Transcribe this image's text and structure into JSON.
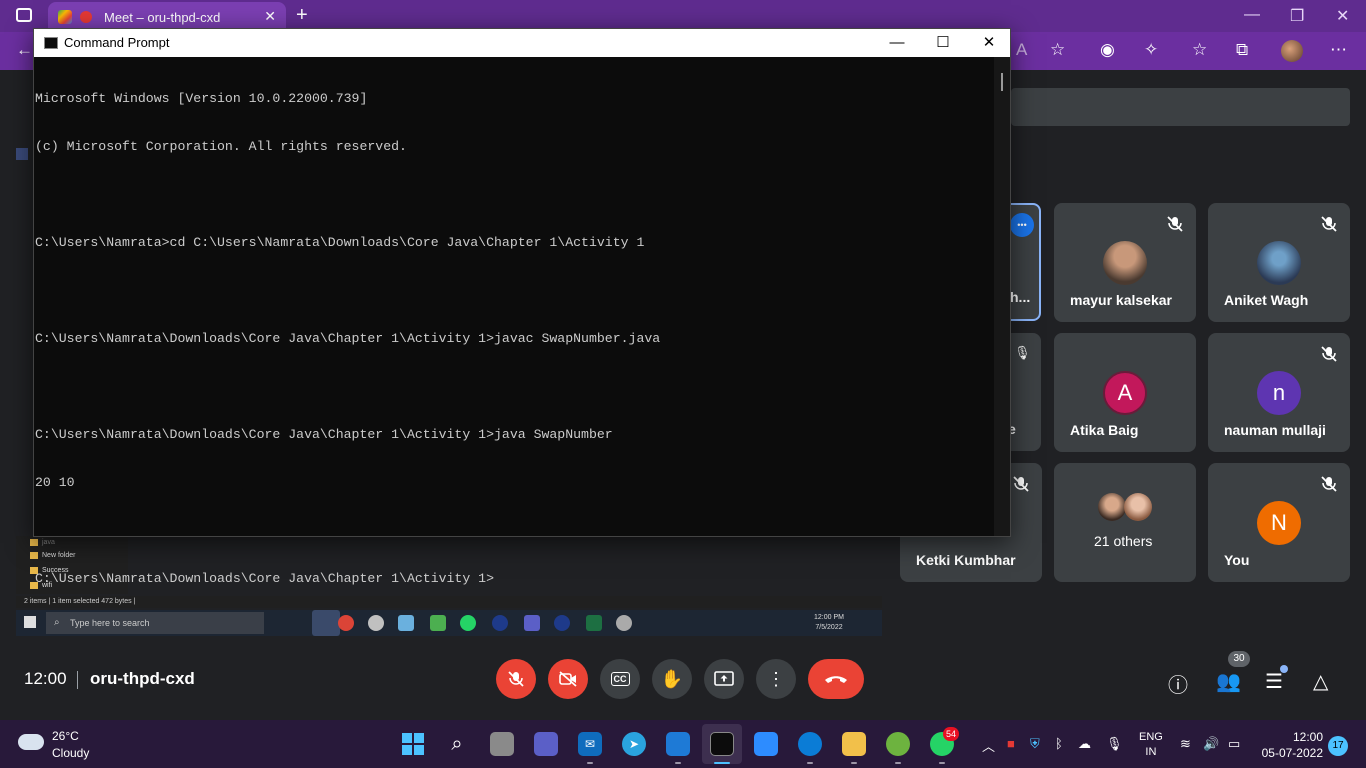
{
  "browser": {
    "tab_title": "Meet – oru-thpd-cxd",
    "close_glyph": "✕",
    "new_tab_glyph": "+",
    "minimize_glyph": "—",
    "restore_glyph": "❐",
    "window_close_glyph": "✕"
  },
  "cmd": {
    "title": "Command Prompt",
    "lines": [
      "Microsoft Windows [Version 10.0.22000.739]",
      "(c) Microsoft Corporation. All rights reserved.",
      "",
      "C:\\Users\\Namrata>cd C:\\Users\\Namrata\\Downloads\\Core Java\\Chapter 1\\Activity 1",
      "",
      "C:\\Users\\Namrata\\Downloads\\Core Java\\Chapter 1\\Activity 1>javac SwapNumber.java",
      "",
      "C:\\Users\\Namrata\\Downloads\\Core Java\\Chapter 1\\Activity 1>java SwapNumber",
      "20 10",
      "",
      "C:\\Users\\Namrata\\Downloads\\Core Java\\Chapter 1\\Activity 1>"
    ],
    "minimize_glyph": "—",
    "maximize_glyph": "☐",
    "close_glyph": "✕"
  },
  "meet": {
    "participants": [
      {
        "name": "mayur kalsekar",
        "avatar_type": "photo"
      },
      {
        "name": "Aniket Wagh",
        "avatar_type": "photo"
      },
      {
        "name": "Atika Baig",
        "initial": "A",
        "color": "#c2185b"
      },
      {
        "name": "nauman mullaji",
        "initial": "n",
        "color": "#5e35b1"
      },
      {
        "name": "21 others",
        "avatar_type": "group"
      },
      {
        "name": "You",
        "initial": "N",
        "color": "#ef6c00"
      },
      {
        "name": "Ketki Kumbhar"
      }
    ],
    "partial_name_1": "h...",
    "partial_name_2": "e",
    "more_glyph": "•••",
    "time": "12:00",
    "meeting_code": "oru-thpd-cxd",
    "people_count": "30",
    "shared_screen": {
      "folders": [
        "New folder",
        "Success",
        "wifi"
      ],
      "folder_partial": "java",
      "status": "2 items  |  1 item selected  472 bytes  |",
      "search_placeholder": "Type here to search",
      "clock_time": "12:00 PM",
      "clock_date": "7/5/2022"
    }
  },
  "taskbar": {
    "weather_temp": "26°C",
    "weather_condition": "Cloudy",
    "whatsapp_badge": "54",
    "lang_top": "ENG",
    "lang_bottom": "IN",
    "time": "12:00",
    "date": "05-07-2022",
    "notifications": "17"
  }
}
